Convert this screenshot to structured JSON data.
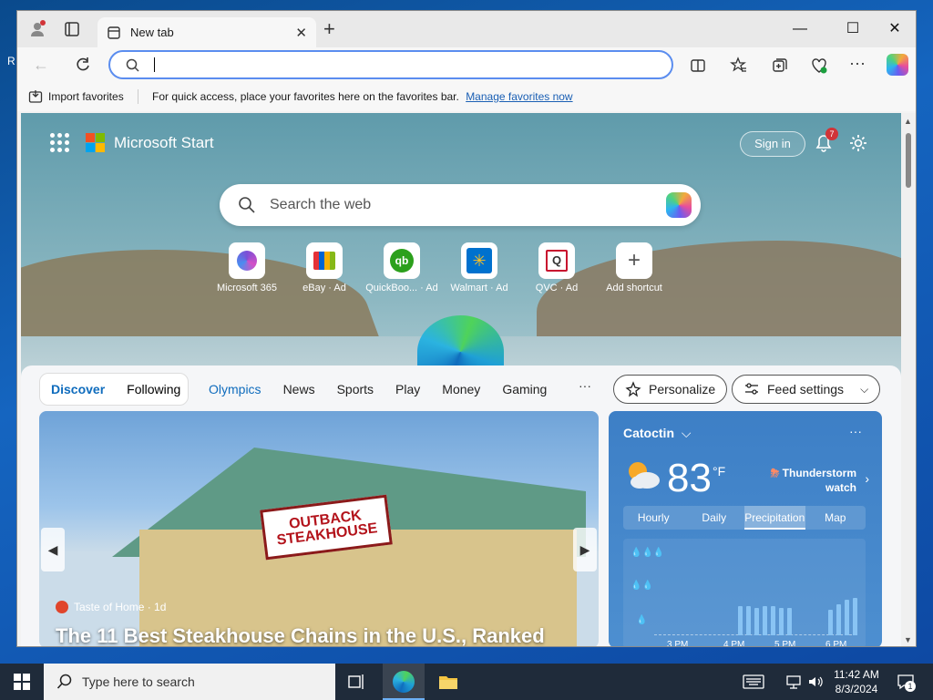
{
  "tab": {
    "title": "New tab"
  },
  "window_controls": {
    "minimize": "—",
    "maximize": "☐",
    "close": "✕"
  },
  "address_bar": {
    "value": "",
    "placeholder": ""
  },
  "favorites_bar": {
    "import": "Import favorites",
    "message": "For quick access, place your favorites here on the favorites bar.",
    "link": "Manage favorites now"
  },
  "start": {
    "brand": "Microsoft Start",
    "signin": "Sign in",
    "notification_count": "7",
    "search_placeholder": "Search the web",
    "shortcuts": [
      {
        "label": "Microsoft 365",
        "icon": "m365-icon"
      },
      {
        "label": "eBay · Ad",
        "icon": "ebay-icon"
      },
      {
        "label": "QuickBoo... · Ad",
        "icon": "quickbooks-icon"
      },
      {
        "label": "Walmart · Ad",
        "icon": "walmart-icon"
      },
      {
        "label": "QVC · Ad",
        "icon": "qvc-icon"
      },
      {
        "label": "Add shortcut",
        "icon": "plus-icon"
      }
    ]
  },
  "feed": {
    "pivots": [
      "Discover",
      "Following"
    ],
    "categories": [
      "Olympics",
      "News",
      "Sports",
      "Play",
      "Money",
      "Gaming"
    ],
    "more": "···",
    "personalize": "Personalize",
    "feed_settings": "Feed settings",
    "hero": {
      "source": "Taste of Home · 1d",
      "headline": "The 11 Best Steakhouse Chains in the U.S., Ranked",
      "sign_text": "OUTBACK STEAKHOUSE"
    }
  },
  "weather": {
    "location": "Catoctin",
    "temp": "83",
    "unit": "°F",
    "alert": "Thunderstorm watch",
    "tabs": [
      "Hourly",
      "Daily",
      "Precipitation",
      "Map"
    ],
    "active_tab": "Precipitation",
    "times": [
      "3 PM",
      "4 PM",
      "5 PM",
      "6 PM"
    ],
    "precipitation_bar_levels": [
      0.45,
      0.45,
      0.43,
      0.45,
      0.45,
      0.43,
      0.43,
      0,
      0,
      0,
      0,
      0.4,
      0.48,
      0.55,
      0.58
    ]
  },
  "taskbar": {
    "search_placeholder": "Type here to search",
    "time": "11:42 AM",
    "date": "8/3/2024",
    "notification_count": "1"
  },
  "colors": {
    "accent": "#0f6cbd",
    "taskbar": "#1f2b3a",
    "weather_bg": "#3d7fc6"
  }
}
